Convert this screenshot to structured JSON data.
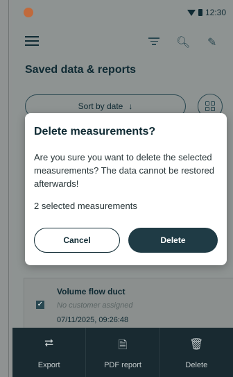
{
  "status_bar": {
    "time": "12:30"
  },
  "header": {
    "title": "Saved data & reports"
  },
  "sort": {
    "label": "Sort by date",
    "arrow": "↓"
  },
  "card": {
    "title": "Volume flow duct",
    "customer": "No customer assigned",
    "date": "07/11/2025, 09:26:48"
  },
  "dialog": {
    "title": "Delete measurements?",
    "message": "Are you sure you want to delete the selected measurements? The data cannot be restored afterwards!",
    "count_text": "2 selected measurements",
    "cancel_label": "Cancel",
    "delete_label": "Delete"
  },
  "bottom_bar": {
    "items": [
      {
        "label": "Export",
        "icon": "share-icon"
      },
      {
        "label": "PDF report",
        "icon": "pdf-document-icon"
      },
      {
        "label": "Delete",
        "icon": "trash-icon"
      }
    ]
  },
  "colors": {
    "primary_dark": "#1f3b45",
    "text_dark": "#0f2a33",
    "bottom_bar_bg": "#192a31",
    "scrim_bg": "#8e9392",
    "brand_logo": "#c06a3c"
  }
}
